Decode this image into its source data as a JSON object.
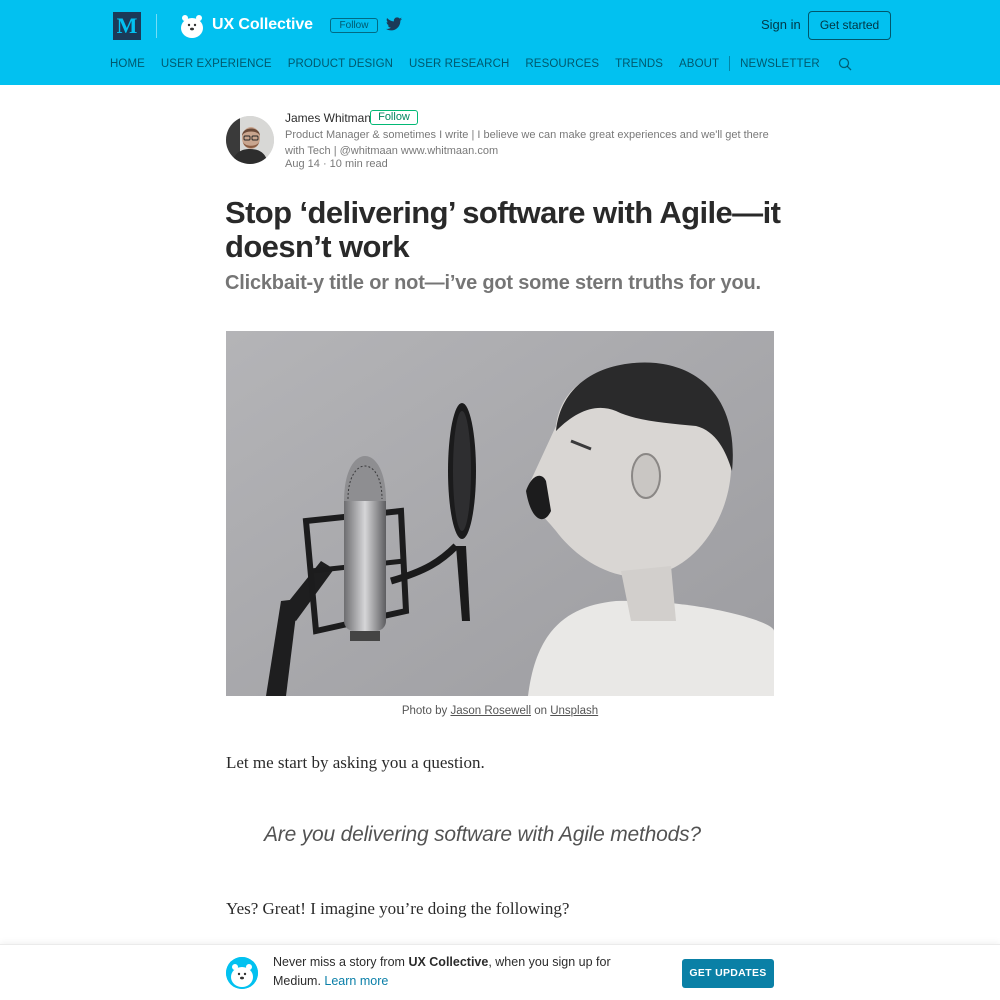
{
  "header": {
    "medium_logo": "M",
    "publication_name": "UX Collective",
    "follow_label": "Follow",
    "signin_label": "Sign in",
    "get_started_label": "Get started",
    "nav": [
      "HOME",
      "USER EXPERIENCE",
      "PRODUCT DESIGN",
      "USER RESEARCH",
      "RESOURCES",
      "TRENDS",
      "ABOUT",
      "NEWSLETTER"
    ],
    "colors": {
      "background": "#02c1f0",
      "medium_logo_bg": "#1b3a58"
    }
  },
  "author": {
    "name": "James Whitman",
    "follow_label": "Follow",
    "bio": "Product Manager & sometimes I write | I believe we can make great experiences and we'll get there with Tech | @whitmaan www.whitmaan.com",
    "date": "Aug 14",
    "separator": "·",
    "read_time": "10 min read"
  },
  "article": {
    "title": "Stop ‘delivering’ software with Agile—it doesn’t work",
    "subtitle": "Clickbait-y title or not—i’ve got some stern truths for you.",
    "caption": {
      "prefix": "Photo by",
      "photographer": "Jason Rosewell",
      "middle": "on",
      "source": "Unsplash"
    },
    "paragraph_1": "Let me start by asking you a question.",
    "pullquote": "Are you delivering software with Agile methods?",
    "paragraph_2": "Yes? Great! I imagine you’re doing the following?"
  },
  "bottom_bar": {
    "text_before": "Never miss a story from ",
    "publication": "UX Collective",
    "text_after": ", when you sign up for Medium. ",
    "learn_more": "Learn more",
    "button_label": "GET UPDATES",
    "colors": {
      "button": "#0a80a6"
    }
  },
  "icons": [
    "medium-logo",
    "ux-collective-logo",
    "twitter-icon",
    "search-icon",
    "author-avatar",
    "bottom-bar-logo"
  ]
}
